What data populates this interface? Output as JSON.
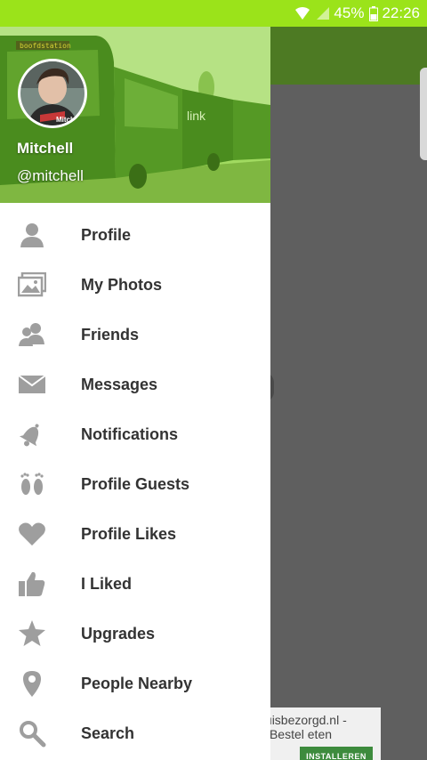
{
  "status_bar": {
    "battery": "45%",
    "time": "22:26",
    "icons": [
      "wifi-icon",
      "signal-icon",
      "battery-icon"
    ]
  },
  "drawer": {
    "user": {
      "name": "Mitchell",
      "handle": "@mitchell"
    },
    "header_sign_texts": [
      "boofdstation",
      "link"
    ],
    "items": [
      {
        "label": "Profile",
        "icon": "person-icon"
      },
      {
        "label": "My Photos",
        "icon": "photos-icon"
      },
      {
        "label": "Friends",
        "icon": "friends-icon"
      },
      {
        "label": "Messages",
        "icon": "envelope-icon"
      },
      {
        "label": "Notifications",
        "icon": "bell-icon"
      },
      {
        "label": "Profile Guests",
        "icon": "footprints-icon"
      },
      {
        "label": "Profile Likes",
        "icon": "heart-icon"
      },
      {
        "label": "I Liked",
        "icon": "thumbs-up-icon"
      },
      {
        "label": "Upgrades",
        "icon": "star-icon"
      },
      {
        "label": "People Nearby",
        "icon": "location-pin-icon"
      },
      {
        "label": "Search",
        "icon": "search-icon"
      }
    ]
  },
  "ad": {
    "line1": "thuisbezorgd.nl -",
    "line2": "Bestel eten",
    "button": "INSTALLEREN"
  },
  "colors": {
    "status_bar": "#9be31a",
    "toolbar": "#4d7a23",
    "scrim": "#5f5f5f",
    "icon_grey": "#9e9e9e",
    "menu_text": "#333333"
  }
}
